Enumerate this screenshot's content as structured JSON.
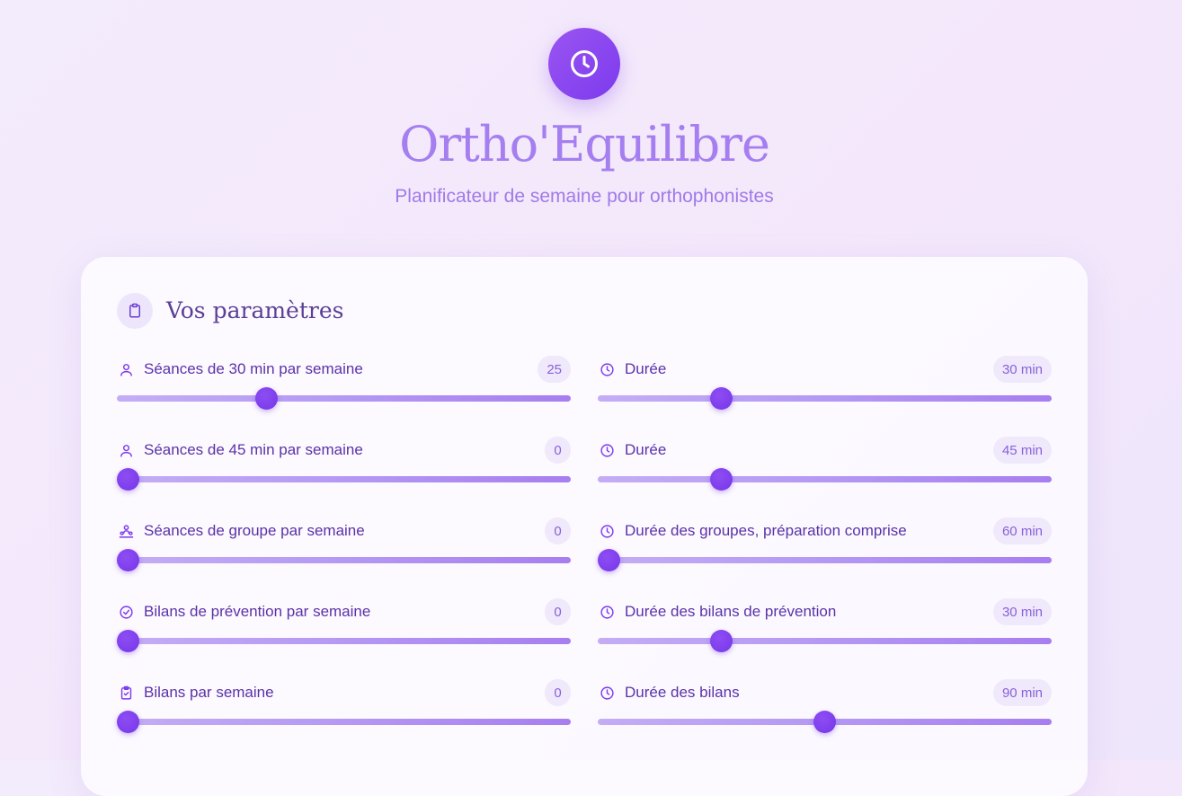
{
  "app": {
    "title": "Ortho'Equilibre",
    "subtitle": "Planificateur de semaine pour orthophonistes",
    "logo_icon": "clock-icon"
  },
  "colors": {
    "accent": "#7c3aed",
    "title": "#a57ff0",
    "label": "#5b32a8",
    "badge_bg": "#efe9fb"
  },
  "settings_card": {
    "title": "Vos paramètres",
    "icon": "clipboard-icon"
  },
  "params": [
    {
      "id": "seances-30",
      "icon": "user-icon",
      "label": "Séances de 30 min par semaine",
      "value": "25",
      "level": 0.32
    },
    {
      "id": "duree-30",
      "icon": "clock-icon",
      "label": "Durée",
      "value": "30 min",
      "level": 0.26
    },
    {
      "id": "seances-45",
      "icon": "user-icon",
      "label": "Séances de 45 min par semaine",
      "value": "0",
      "level": 0.0
    },
    {
      "id": "duree-45",
      "icon": "clock-icon",
      "label": "Durée",
      "value": "45 min",
      "level": 0.26
    },
    {
      "id": "seances-groupe",
      "icon": "group-icon",
      "label": "Séances de groupe par semaine",
      "value": "0",
      "level": 0.0
    },
    {
      "id": "duree-groupe",
      "icon": "clock-icon",
      "label": "Durée des groupes, préparation comprise",
      "value": "60 min",
      "level": 0.0
    },
    {
      "id": "bilans-prevention",
      "icon": "check-circle-icon",
      "label": "Bilans de prévention par semaine",
      "value": "0",
      "level": 0.0
    },
    {
      "id": "duree-bilans-prevention",
      "icon": "clock-icon",
      "label": "Durée des bilans de prévention",
      "value": "30 min",
      "level": 0.26
    },
    {
      "id": "bilans",
      "icon": "clipboard-check-icon",
      "label": "Bilans par semaine",
      "value": "0",
      "level": 0.0
    },
    {
      "id": "duree-bilans",
      "icon": "clock-icon",
      "label": "Durée des bilans",
      "value": "90 min",
      "level": 0.5
    }
  ]
}
